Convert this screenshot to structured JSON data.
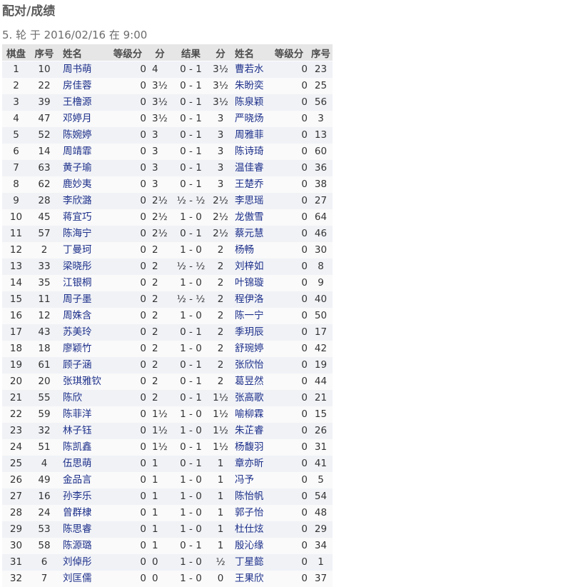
{
  "title": "配对/成绩",
  "round_line": "5. 轮 于 2016/02/16 在 9:00",
  "headers": {
    "board": "棋盘",
    "white_no": "序号",
    "white_name": "姓名",
    "white_rating": "等级分",
    "white_pts": "分",
    "result": "结果",
    "black_pts": "分",
    "black_name": "姓名",
    "black_rating": "等级分",
    "black_no": "序号"
  },
  "pairings": [
    [
      "1",
      "10",
      "周书萌",
      "0",
      "4",
      "0 - 1",
      "3½",
      "曹若水",
      "0",
      "23"
    ],
    [
      "2",
      "22",
      "房佳蓉",
      "0",
      "3½",
      "0 - 1",
      "3½",
      "朱盼奕",
      "0",
      "25"
    ],
    [
      "3",
      "39",
      "王橹源",
      "0",
      "3½",
      "0 - 1",
      "3½",
      "陈泉颖",
      "0",
      "56"
    ],
    [
      "4",
      "47",
      "邓婷月",
      "0",
      "3½",
      "0 - 1",
      "3",
      "严晓炀",
      "0",
      "3"
    ],
    [
      "5",
      "52",
      "陈婉婷",
      "0",
      "3",
      "0 - 1",
      "3",
      "周雅菲",
      "0",
      "13"
    ],
    [
      "6",
      "14",
      "周靖霏",
      "0",
      "3",
      "0 - 1",
      "3",
      "陈诗琦",
      "0",
      "60"
    ],
    [
      "7",
      "63",
      "黄子瑜",
      "0",
      "3",
      "0 - 1",
      "3",
      "温佳睿",
      "0",
      "36"
    ],
    [
      "8",
      "62",
      "鹿妙夷",
      "0",
      "3",
      "0 - 1",
      "3",
      "王楚乔",
      "0",
      "38"
    ],
    [
      "9",
      "28",
      "李欣潞",
      "0",
      "2½",
      "½ - ½",
      "2½",
      "李思瑶",
      "0",
      "27"
    ],
    [
      "10",
      "45",
      "蒋宜巧",
      "0",
      "2½",
      "1 - 0",
      "2½",
      "龙傲雪",
      "0",
      "64"
    ],
    [
      "11",
      "57",
      "陈海宁",
      "0",
      "2½",
      "0 - 1",
      "2½",
      "蔡元慧",
      "0",
      "46"
    ],
    [
      "12",
      "2",
      "丁曼珂",
      "0",
      "2",
      "1 - 0",
      "2",
      "杨畅",
      "0",
      "30"
    ],
    [
      "13",
      "33",
      "梁晓彤",
      "0",
      "2",
      "½ - ½",
      "2",
      "刘梓如",
      "0",
      "8"
    ],
    [
      "14",
      "35",
      "江银桐",
      "0",
      "2",
      "1 - 0",
      "2",
      "叶锦璇",
      "0",
      "9"
    ],
    [
      "15",
      "11",
      "周子墨",
      "0",
      "2",
      "½ - ½",
      "2",
      "程伊洛",
      "0",
      "40"
    ],
    [
      "16",
      "12",
      "周姝含",
      "0",
      "2",
      "1 - 0",
      "2",
      "陈一宁",
      "0",
      "50"
    ],
    [
      "17",
      "43",
      "苏美玲",
      "0",
      "2",
      "0 - 1",
      "2",
      "季玥辰",
      "0",
      "17"
    ],
    [
      "18",
      "18",
      "廖颖竹",
      "0",
      "2",
      "1 - 0",
      "2",
      "舒琬婷",
      "0",
      "42"
    ],
    [
      "19",
      "61",
      "顾子涵",
      "0",
      "2",
      "0 - 1",
      "2",
      "张欣怡",
      "0",
      "19"
    ],
    [
      "20",
      "20",
      "张琪雅钦",
      "0",
      "2",
      "0 - 1",
      "2",
      "葛昱然",
      "0",
      "44"
    ],
    [
      "21",
      "55",
      "陈欣",
      "0",
      "2",
      "0 - 1",
      "1½",
      "张高歌",
      "0",
      "21"
    ],
    [
      "22",
      "59",
      "陈菲洋",
      "0",
      "1½",
      "1 - 0",
      "1½",
      "喻柳霖",
      "0",
      "15"
    ],
    [
      "23",
      "32",
      "林子钰",
      "0",
      "1½",
      "1 - 0",
      "1½",
      "朱芷睿",
      "0",
      "26"
    ],
    [
      "24",
      "51",
      "陈凯鑫",
      "0",
      "1½",
      "0 - 1",
      "1½",
      "杨馥羽",
      "0",
      "31"
    ],
    [
      "25",
      "4",
      "伍思萌",
      "0",
      "1",
      "0 - 1",
      "1",
      "章亦昕",
      "0",
      "41"
    ],
    [
      "26",
      "49",
      "金品言",
      "0",
      "1",
      "1 - 0",
      "1",
      "冯予",
      "0",
      "5"
    ],
    [
      "27",
      "16",
      "孙李乐",
      "0",
      "1",
      "1 - 0",
      "1",
      "陈怡帆",
      "0",
      "54"
    ],
    [
      "28",
      "24",
      "曾群棣",
      "0",
      "1",
      "1 - 0",
      "1",
      "郭子怡",
      "0",
      "48"
    ],
    [
      "29",
      "53",
      "陈思睿",
      "0",
      "1",
      "1 - 0",
      "1",
      "杜仕炫",
      "0",
      "29"
    ],
    [
      "30",
      "58",
      "陈源璐",
      "0",
      "1",
      "0 - 1",
      "1",
      "殷沁缘",
      "0",
      "34"
    ],
    [
      "31",
      "6",
      "刘倬彤",
      "0",
      "0",
      "1 - 0",
      "½",
      "丁星懿",
      "0",
      "1"
    ],
    [
      "32",
      "7",
      "刘匡儒",
      "0",
      "0",
      "1 - 0",
      "0",
      "王果欣",
      "0",
      "37"
    ]
  ]
}
